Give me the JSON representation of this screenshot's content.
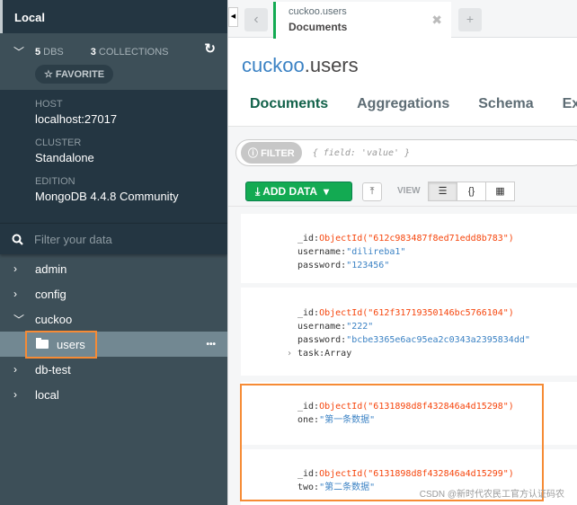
{
  "sidebar": {
    "title": "Local",
    "dbs_count": "5",
    "dbs_label": "DBS",
    "collections_count": "3",
    "collections_label": "COLLECTIONS",
    "favorite": "☆ FAVORITE",
    "host_label": "HOST",
    "host": "localhost:27017",
    "cluster_label": "CLUSTER",
    "cluster": "Standalone",
    "edition_label": "EDITION",
    "edition": "MongoDB 4.4.8 Community",
    "filter_placeholder": "Filter your data",
    "databases": [
      {
        "name": "admin",
        "expanded": false
      },
      {
        "name": "config",
        "expanded": false
      },
      {
        "name": "cuckoo",
        "expanded": true,
        "collections": [
          "users"
        ]
      },
      {
        "name": "db-test",
        "expanded": false
      },
      {
        "name": "local",
        "expanded": false
      }
    ]
  },
  "tab": {
    "namespace": "cuckoo.users",
    "label": "Documents"
  },
  "title": {
    "db": "cuckoo",
    "collection": ".users"
  },
  "subtabs": [
    "Documents",
    "Aggregations",
    "Schema",
    "Exp"
  ],
  "filter": {
    "label": "FILTER",
    "placeholder": "{ field: 'value' }"
  },
  "toolbar": {
    "add_data": "ADD DATA",
    "view_label": "VIEW"
  },
  "documents": [
    {
      "_id": "ObjectId(\"612c983487f8ed71edd8b783\")",
      "username": "\"dilireba1\"",
      "password": "\"123456\""
    },
    {
      "_id": "ObjectId(\"612f31719350146bc5766104\")",
      "username": "\"222\"",
      "password": "\"bcbe3365e6ac95ea2c0343a2395834dd\"",
      "task": "Array"
    },
    {
      "_id": "ObjectId(\"6131898d8f432846a4d15298\")",
      "one": "\"第一条数据\""
    },
    {
      "_id": "ObjectId(\"6131898d8f432846a4d15299\")",
      "two": "\"第二条数据\""
    }
  ],
  "watermark": "CSDN @新时代农民工官方认证码农",
  "colors": {
    "accent": "#13aa52",
    "highlight": "#f68b35",
    "objectid": "#f6450c",
    "string": "#3b82c4"
  }
}
